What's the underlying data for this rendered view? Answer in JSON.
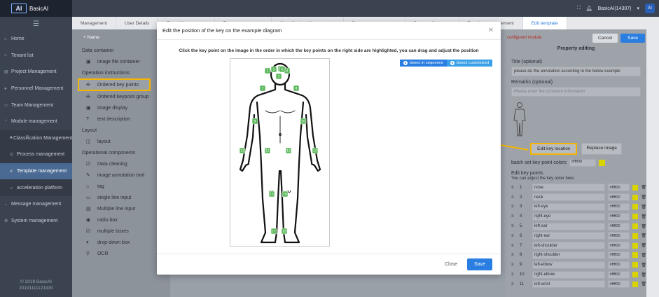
{
  "app": {
    "logo_text": "AI",
    "name": "BasicAI",
    "user": "BasicAI(14307)",
    "avatar": "AI"
  },
  "sidebar": {
    "items": [
      {
        "label": "Home"
      },
      {
        "label": "Tenant list"
      },
      {
        "label": "Project Management"
      },
      {
        "label": "Personnel Management"
      },
      {
        "label": "Team Management"
      },
      {
        "label": "Module management"
      },
      {
        "label": "Classification Management"
      },
      {
        "label": "Process management"
      },
      {
        "label": "Template management"
      },
      {
        "label": "acceleration platform"
      },
      {
        "label": "Message management"
      },
      {
        "label": "System management"
      }
    ],
    "footer_line1": "© 2019 BasicAI",
    "footer_line2": "20191111121930"
  },
  "tabs": [
    {
      "label": "Management"
    },
    {
      "label": "User Details"
    },
    {
      "label": "Team Management"
    },
    {
      "label": "Team management"
    },
    {
      "label": "Classification Management"
    },
    {
      "label": "Process management"
    },
    {
      "label": "Process Category"
    },
    {
      "label": "Template management"
    },
    {
      "label": "Edit template"
    }
  ],
  "components": {
    "add_name": "+ Name",
    "groups": [
      {
        "title": "Data container",
        "items": [
          "image file container"
        ]
      },
      {
        "title": "Operation instructions",
        "items": [
          "Ordered key points",
          "Ordered keypoint group",
          "Image display",
          "text description"
        ]
      },
      {
        "title": "Layout",
        "items": [
          "layout"
        ]
      },
      {
        "title": "Operational components",
        "items": [
          "Data cleaning",
          "image annotation tool",
          "tag",
          "single line input",
          "Multiple line input",
          "radio box",
          "multiple boxes",
          "drop-down box",
          "OCR"
        ]
      }
    ]
  },
  "property": {
    "cancel": "Cancel",
    "save": "Save",
    "alert": "configured module",
    "title": "Property editing",
    "title_label": "Title (optional)",
    "title_value": "please do the annotation according to the below example",
    "remarks_label": "Remarks (optional)",
    "remarks_placeholder": "Please enter the comment information",
    "edit_key_location": "Edit key location",
    "replace_image": "Replace image",
    "batch_label": "batch set key point colors",
    "batch_color": "#ffff00",
    "edit_points_label": "Edit key points",
    "edit_points_hint": "You can adjust the key order here",
    "keypoints": [
      {
        "num": "1",
        "name": "nose",
        "color": "#ffff00"
      },
      {
        "num": "2",
        "name": "neck",
        "color": "#ffff00"
      },
      {
        "num": "3",
        "name": "left-eye",
        "color": "#ffff00"
      },
      {
        "num": "4",
        "name": "right-eye",
        "color": "#ffff00"
      },
      {
        "num": "5",
        "name": "left-ear",
        "color": "#ffff00"
      },
      {
        "num": "6",
        "name": "right-ear",
        "color": "#ffff00"
      },
      {
        "num": "7",
        "name": "left-shoulder",
        "color": "#ffff00"
      },
      {
        "num": "8",
        "name": "right-shoulder",
        "color": "#ffff00"
      },
      {
        "num": "9",
        "name": "left-elbow",
        "color": "#ffff00"
      },
      {
        "num": "10",
        "name": "right-elbow",
        "color": "#ffff00"
      },
      {
        "num": "11",
        "name": "left-wrist",
        "color": "#ffff00"
      }
    ]
  },
  "modal": {
    "title": "Edit the position of the key on the example diagram",
    "instruction": "Click the key point on the image in the order in which the key points on the right side are highlighted, you can drag and adjust the position",
    "bisect_sequence": "bisect in sequence",
    "bisect_customized": "bisect customized",
    "close": "Close",
    "save": "Save",
    "markers": [
      "1",
      "2",
      "3",
      "4",
      "5",
      "6",
      "7",
      "8",
      "9",
      "10",
      "11",
      "12",
      "13",
      "14",
      "15",
      "16",
      "17",
      "18"
    ]
  },
  "colors": {
    "accent": "#2a7de1",
    "highlight": "#f5b400",
    "keypoint": "#5cb85c",
    "swatch": "#d9d300"
  }
}
